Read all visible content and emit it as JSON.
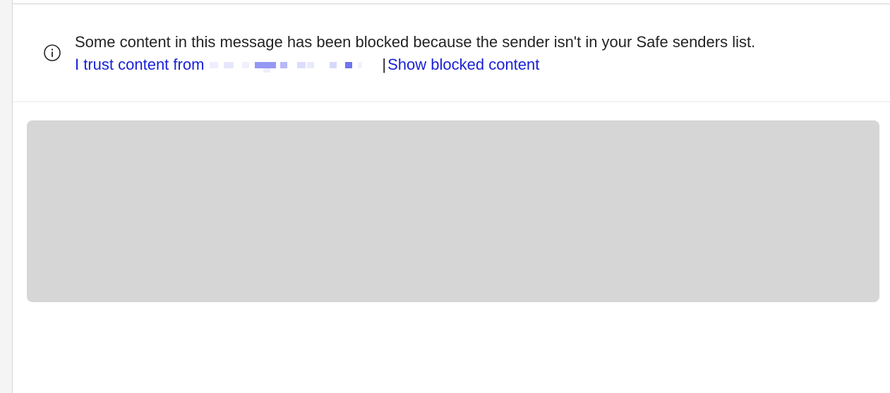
{
  "banner": {
    "message": "Some content in this message has been blocked because the sender isn't in your Safe senders list.",
    "trust_link_label": "I trust content from",
    "separator": "|",
    "show_blocked_label": "Show blocked content",
    "icon": "info-icon"
  },
  "colors": {
    "link": "#1a22d6",
    "text": "#242424",
    "placeholder": "#d6d6d6",
    "redaction": "#6f74f0"
  }
}
